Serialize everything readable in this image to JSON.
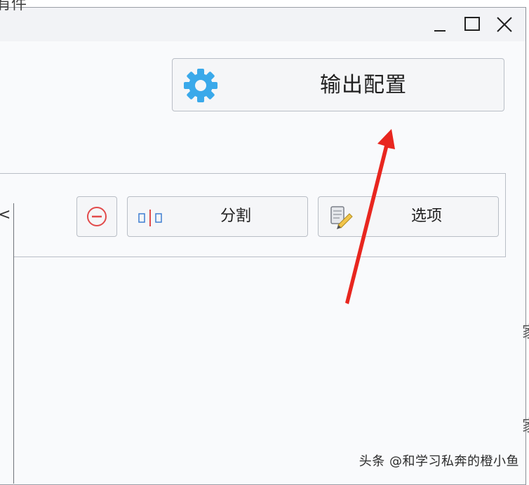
{
  "window": {
    "controls": {
      "minimize_icon": "minimize-icon",
      "maximize_icon": "maximize-icon",
      "close_icon": "close-icon"
    }
  },
  "output_config": {
    "label": "输出配置",
    "icon": "gear-icon",
    "icon_color": "#3aa9ea"
  },
  "toolbar": {
    "remove_icon": "minus-circle-icon",
    "remove_color": "#e24b4b",
    "split": {
      "label": "分割",
      "icon": "split-icon"
    },
    "options": {
      "label": "选项",
      "icon": "options-icon"
    }
  },
  "annotation": {
    "arrow_color": "#e8261f"
  },
  "fragments": {
    "top_left": "有件",
    "right_1": "家",
    "right_2": "家"
  },
  "watermark": "头条 @和学习私奔的橙小鱼"
}
